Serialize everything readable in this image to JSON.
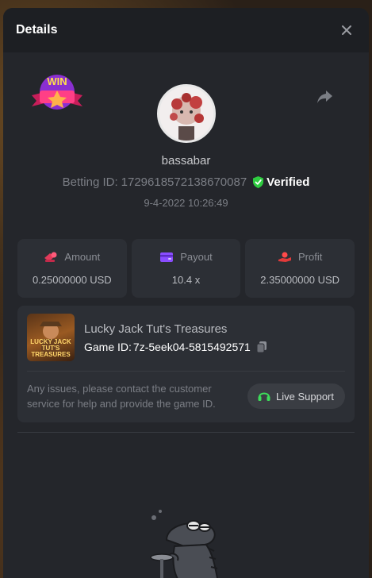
{
  "header": {
    "title": "Details"
  },
  "badge": {
    "text": "WIN"
  },
  "user": {
    "name": "bassabar",
    "betting_label": "Betting ID:",
    "betting_id": "1729618572138670087",
    "verified": "Verified",
    "date": "9-4-2022 10:26:49"
  },
  "stats": [
    {
      "label": "Amount",
      "value": "0.25000000 USD",
      "icon": "coins-icon",
      "color": "#e23a5a"
    },
    {
      "label": "Payout",
      "value": "10.4 x",
      "icon": "wallet-icon",
      "color": "#8a4dff"
    },
    {
      "label": "Profit",
      "value": "2.35000000 USD",
      "icon": "hand-coin-icon",
      "color": "#e23a3a"
    }
  ],
  "game": {
    "name": "Lucky Jack Tut's Treasures",
    "thumb_text": "LUCKY JACK TUT'S TREASURES",
    "id_label": "Game ID:",
    "id": "7z-5eek04-5815492571"
  },
  "help": {
    "text": "Any issues, please contact the customer service for help and provide the game ID.",
    "button": "Live Support"
  },
  "colors": {
    "verified": "#2ecc40",
    "support_icon": "#3ddc5a"
  }
}
